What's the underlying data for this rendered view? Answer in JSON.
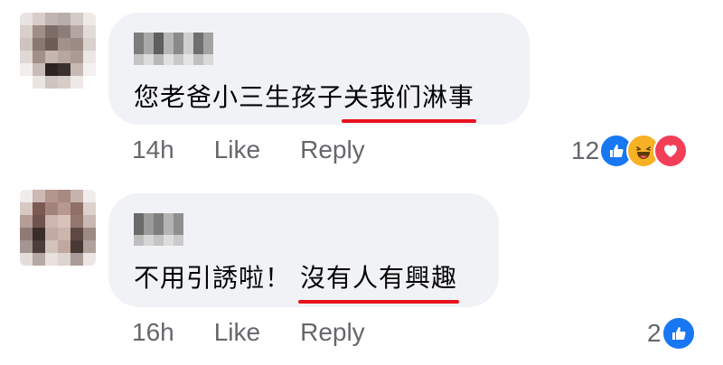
{
  "comments": [
    {
      "text_plain": "您老爸小三生孩子",
      "text_highlight": "关我们淋事",
      "time": "14h",
      "like_label": "Like",
      "reply_label": "Reply",
      "reaction_count": "12",
      "reactions": [
        "like-icon",
        "haha-icon",
        "love-icon"
      ]
    },
    {
      "text_plain": "不用引誘啦！",
      "text_highlight": "沒有人有興趣",
      "time": "16h",
      "like_label": "Like",
      "reply_label": "Reply",
      "reaction_count": "2",
      "reactions": [
        "like-icon"
      ]
    }
  ],
  "colors": {
    "bubble": "#f0f2f5",
    "underline": "#e8111d",
    "meta_text": "#65676b",
    "like_blue": "#1877f2",
    "haha_yellow": "#f7b125",
    "love_red": "#f33e58"
  }
}
